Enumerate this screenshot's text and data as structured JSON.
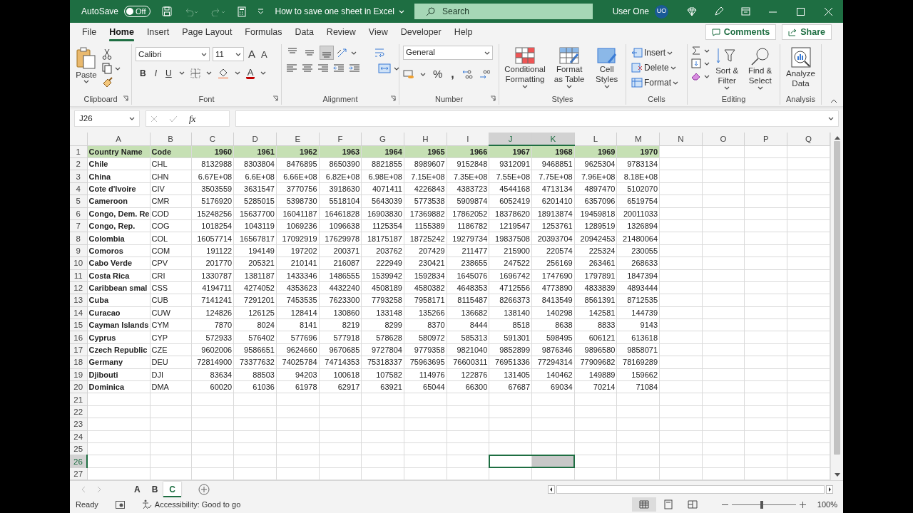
{
  "title_bar": {
    "autosave_label": "AutoSave",
    "autosave_on": false,
    "autosave_state": "Off",
    "undo_disabled": true,
    "redo_disabled": true,
    "document_title": "How to save one sheet in Excel",
    "search_placeholder": "Search",
    "user_name": "User One",
    "user_initials": "UO"
  },
  "menu_tabs": [
    {
      "label": "File",
      "selected": false
    },
    {
      "label": "Home",
      "selected": true
    },
    {
      "label": "Insert",
      "selected": false
    },
    {
      "label": "Page Layout",
      "selected": false
    },
    {
      "label": "Formulas",
      "selected": false
    },
    {
      "label": "Data",
      "selected": false
    },
    {
      "label": "Review",
      "selected": false
    },
    {
      "label": "View",
      "selected": false
    },
    {
      "label": "Developer",
      "selected": false
    },
    {
      "label": "Help",
      "selected": false
    }
  ],
  "comments_button": "Comments",
  "share_button": "Share",
  "ribbon": {
    "paste": "Paste",
    "font_name": "Calibri",
    "font_size": "11",
    "grow_font": "A",
    "shrink_font": "A",
    "bold": "B",
    "italic": "I",
    "underline": "U",
    "font_color": "A",
    "vertical_align": [
      {
        "selected": false
      },
      {
        "selected": false
      },
      {
        "selected": true
      }
    ],
    "number_format": "General",
    "percent": "%",
    "comma": ",",
    "conditional_formatting": "Conditional Formatting",
    "format_as_table": "Format as Table",
    "cell_styles": "Cell Styles",
    "insert": "Insert",
    "delete": "Delete",
    "format": "Format",
    "sort_filter": "Sort & Filter",
    "find_select": "Find & Select",
    "analyze_data": "Analyze Data",
    "groups": [
      "Clipboard",
      "Font",
      "Alignment",
      "Number",
      "Styles",
      "Cells",
      "Editing",
      "Analysis"
    ]
  },
  "formula_bar": {
    "name_box": "J26",
    "function_label": "fx"
  },
  "columns": [
    {
      "label": "A",
      "selected": false
    },
    {
      "label": "B",
      "selected": false
    },
    {
      "label": "C",
      "selected": false
    },
    {
      "label": "D",
      "selected": false
    },
    {
      "label": "E",
      "selected": false
    },
    {
      "label": "F",
      "selected": false
    },
    {
      "label": "G",
      "selected": false
    },
    {
      "label": "H",
      "selected": false
    },
    {
      "label": "I",
      "selected": false
    },
    {
      "label": "J",
      "selected": true
    },
    {
      "label": "K",
      "selected": true
    },
    {
      "label": "L",
      "selected": false
    },
    {
      "label": "M",
      "selected": false
    },
    {
      "label": "N",
      "selected": false
    },
    {
      "label": "O",
      "selected": false
    },
    {
      "label": "P",
      "selected": false
    },
    {
      "label": "Q",
      "selected": false
    }
  ],
  "rows": [
    {
      "number": "1",
      "selected": false,
      "kind": "header",
      "cells": [
        "Country Name",
        "Code",
        "1960",
        "1961",
        "1962",
        "1963",
        "1964",
        "1965",
        "1966",
        "1967",
        "1968",
        "1969",
        "1970"
      ]
    },
    {
      "number": "2",
      "selected": false,
      "cells": [
        "Chile",
        "CHL",
        "8132988",
        "8303804",
        "8476895",
        "8650390",
        "8821855",
        "8989607",
        "9152848",
        "9312091",
        "9468851",
        "9625304",
        "9783134"
      ]
    },
    {
      "number": "3",
      "selected": false,
      "cells": [
        "China",
        "CHN",
        "6.67E+08",
        "6.6E+08",
        "6.66E+08",
        "6.82E+08",
        "6.98E+08",
        "7.15E+08",
        "7.35E+08",
        "7.55E+08",
        "7.75E+08",
        "7.96E+08",
        "8.18E+08"
      ]
    },
    {
      "number": "4",
      "selected": false,
      "cells": [
        "Cote d'Ivoire",
        "CIV",
        "3503559",
        "3631547",
        "3770756",
        "3918630",
        "4071411",
        "4226843",
        "4383723",
        "4544168",
        "4713134",
        "4897470",
        "5102070"
      ]
    },
    {
      "number": "5",
      "selected": false,
      "cells": [
        "Cameroon",
        "CMR",
        "5176920",
        "5285015",
        "5398730",
        "5518104",
        "5643039",
        "5773538",
        "5909874",
        "6052419",
        "6201410",
        "6357096",
        "6519754"
      ]
    },
    {
      "number": "6",
      "selected": false,
      "cells": [
        "Congo, Dem. Re",
        "COD",
        "15248256",
        "15637700",
        "16041187",
        "16461828",
        "16903830",
        "17369882",
        "17862052",
        "18378620",
        "18913874",
        "19459818",
        "20011033"
      ]
    },
    {
      "number": "7",
      "selected": false,
      "cells": [
        "Congo, Rep.",
        "COG",
        "1018254",
        "1043119",
        "1069236",
        "1096638",
        "1125354",
        "1155389",
        "1186782",
        "1219547",
        "1253761",
        "1289519",
        "1326894"
      ]
    },
    {
      "number": "8",
      "selected": false,
      "cells": [
        "Colombia",
        "COL",
        "16057714",
        "16567817",
        "17092919",
        "17629978",
        "18175187",
        "18725242",
        "19279734",
        "19837508",
        "20393704",
        "20942453",
        "21480064"
      ]
    },
    {
      "number": "9",
      "selected": false,
      "cells": [
        "Comoros",
        "COM",
        "191122",
        "194149",
        "197202",
        "200371",
        "203762",
        "207429",
        "211477",
        "215900",
        "220574",
        "225324",
        "230055"
      ]
    },
    {
      "number": "10",
      "selected": false,
      "cells": [
        "Cabo Verde",
        "CPV",
        "201770",
        "205321",
        "210141",
        "216087",
        "222949",
        "230421",
        "238655",
        "247522",
        "256169",
        "263461",
        "268633"
      ]
    },
    {
      "number": "11",
      "selected": false,
      "cells": [
        "Costa Rica",
        "CRI",
        "1330787",
        "1381187",
        "1433346",
        "1486555",
        "1539942",
        "1592834",
        "1645076",
        "1696742",
        "1747690",
        "1797891",
        "1847394"
      ]
    },
    {
      "number": "12",
      "selected": false,
      "cells": [
        "Caribbean smal",
        "CSS",
        "4194711",
        "4274052",
        "4353623",
        "4432240",
        "4508189",
        "4580382",
        "4648353",
        "4712556",
        "4773890",
        "4833839",
        "4893444"
      ]
    },
    {
      "number": "13",
      "selected": false,
      "cells": [
        "Cuba",
        "CUB",
        "7141241",
        "7291201",
        "7453535",
        "7623300",
        "7793258",
        "7958171",
        "8115487",
        "8266373",
        "8413549",
        "8561391",
        "8712535"
      ]
    },
    {
      "number": "14",
      "selected": false,
      "cells": [
        "Curacao",
        "CUW",
        "124826",
        "126125",
        "128414",
        "130860",
        "133148",
        "135266",
        "136682",
        "138140",
        "140298",
        "142581",
        "144739"
      ]
    },
    {
      "number": "15",
      "selected": false,
      "cells": [
        "Cayman Islands",
        "CYM",
        "7870",
        "8024",
        "8141",
        "8219",
        "8299",
        "8370",
        "8444",
        "8518",
        "8638",
        "8833",
        "9143"
      ]
    },
    {
      "number": "16",
      "selected": false,
      "cells": [
        "Cyprus",
        "CYP",
        "572933",
        "576402",
        "577696",
        "577918",
        "578628",
        "580972",
        "585313",
        "591301",
        "598495",
        "606121",
        "613618"
      ]
    },
    {
      "number": "17",
      "selected": false,
      "cells": [
        "Czech Republic",
        "CZE",
        "9602006",
        "9586651",
        "9624660",
        "9670685",
        "9727804",
        "9779358",
        "9821040",
        "9852899",
        "9876346",
        "9896580",
        "9858071"
      ]
    },
    {
      "number": "18",
      "selected": false,
      "cells": [
        "Germany",
        "DEU",
        "72814900",
        "73377632",
        "74025784",
        "74714353",
        "75318337",
        "75963695",
        "76600311",
        "76951336",
        "77294314",
        "77909682",
        "78169289"
      ]
    },
    {
      "number": "19",
      "selected": false,
      "cells": [
        "Djibouti",
        "DJI",
        "83634",
        "88503",
        "94203",
        "100618",
        "107582",
        "114976",
        "122876",
        "131405",
        "140462",
        "149889",
        "159662"
      ]
    },
    {
      "number": "20",
      "selected": false,
      "cells": [
        "Dominica",
        "DMA",
        "60020",
        "61036",
        "61978",
        "62917",
        "63921",
        "65044",
        "66300",
        "67687",
        "69034",
        "70214",
        "71084"
      ]
    },
    {
      "number": "21",
      "selected": false
    },
    {
      "number": "22",
      "selected": false
    },
    {
      "number": "23",
      "selected": false
    },
    {
      "number": "24",
      "selected": false
    },
    {
      "number": "25",
      "selected": false
    },
    {
      "number": "26",
      "selected": true
    },
    {
      "number": "27",
      "selected": false
    }
  ],
  "sheets": [
    {
      "label": "A",
      "selected": true,
      "active": false
    },
    {
      "label": "B",
      "selected": true,
      "active": false
    },
    {
      "label": "C",
      "selected": true,
      "active": true
    }
  ],
  "status_bar": {
    "ready": "Ready",
    "accessibility": "Accessibility: Good to go",
    "views": [
      {
        "selected": true
      },
      {
        "selected": false
      },
      {
        "selected": false
      }
    ],
    "zoom": {
      "level": 0.47,
      "reading": "100%"
    }
  }
}
